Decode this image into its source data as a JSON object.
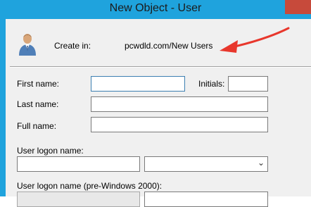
{
  "window": {
    "title": "New Object - User"
  },
  "header": {
    "create_in_label": "Create in:",
    "create_in_value": "pcwdld.com/New Users",
    "icon": "user-icon",
    "annotation_color": "#e8372c"
  },
  "form": {
    "first_name_label": "First name:",
    "first_name_value": "",
    "initials_label": "Initials:",
    "initials_value": "",
    "last_name_label": "Last name:",
    "last_name_value": "",
    "full_name_label": "Full name:",
    "full_name_value": "",
    "logon_name_label": "User logon name:",
    "logon_name_value": "",
    "domain_select_value": "",
    "pre2000_label": "User logon name (pre-Windows 2000):"
  },
  "colors": {
    "titlebar": "#1fa3dd",
    "dialog_bg": "#f0f0f0",
    "close_button": "#c74a3b"
  }
}
